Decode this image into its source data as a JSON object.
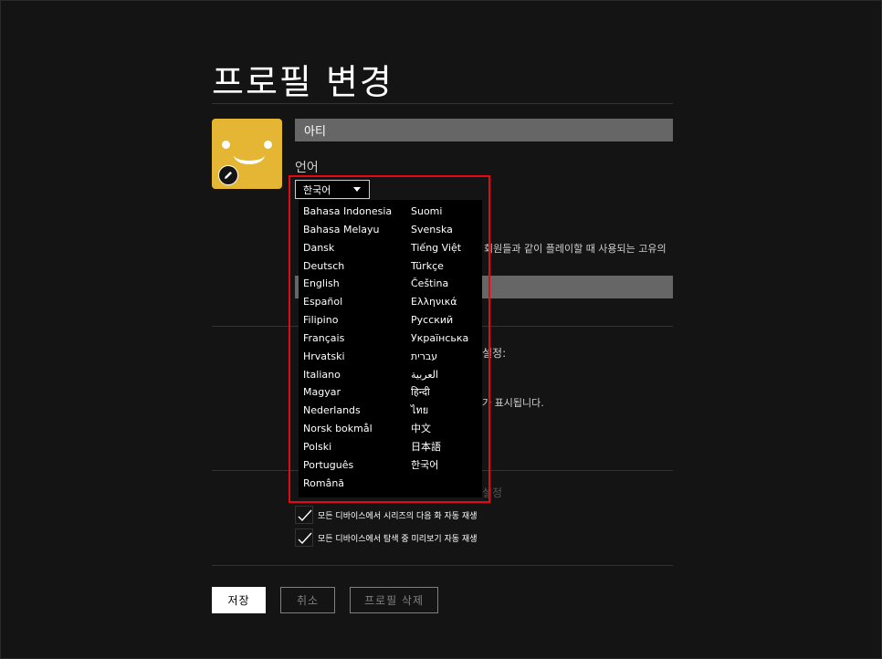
{
  "page": {
    "title": "프로필 변경"
  },
  "profile": {
    "name_value": "아티",
    "avatar_color": "#e4b633",
    "edit_icon": "pencil-icon"
  },
  "language": {
    "label": "언어",
    "selected": "한국어",
    "options_col1": [
      "Bahasa Indonesia",
      "Bahasa Melayu",
      "Dansk",
      "Deutsch",
      "English",
      "Español",
      "Filipino",
      "Français",
      "Hrvatski",
      "Italiano",
      "Magyar",
      "Nederlands",
      "Norsk bokmål",
      "Polski",
      "Português",
      "Română"
    ],
    "options_col2": [
      "Suomi",
      "Svenska",
      "Tiếng Việt",
      "Türkçe",
      "Čeština",
      "Ελληνικά",
      "Русский",
      "Українська",
      "עברית",
      "العربية",
      "हिन्दी",
      "ไทย",
      "中文",
      "日本語",
      "한국어"
    ]
  },
  "background": {
    "game_desc_tail": "회원들과 같이 플레이할 때 사용되는 고유의",
    "maturity_tail": "가 표시됩니다.",
    "settings_frag": "설정:",
    "autoplay_frag": "설정"
  },
  "autoplay": {
    "next_episode": "모든 디바이스에서 시리즈의 다음 화 자동 재생",
    "previews": "모든 디바이스에서 탐색 중 미리보기 자동 재생"
  },
  "buttons": {
    "save": "저장",
    "cancel": "취소",
    "delete": "프로필 삭제"
  },
  "colors": {
    "background": "#141414",
    "highlight": "#e50914",
    "avatar": "#e4b633"
  }
}
